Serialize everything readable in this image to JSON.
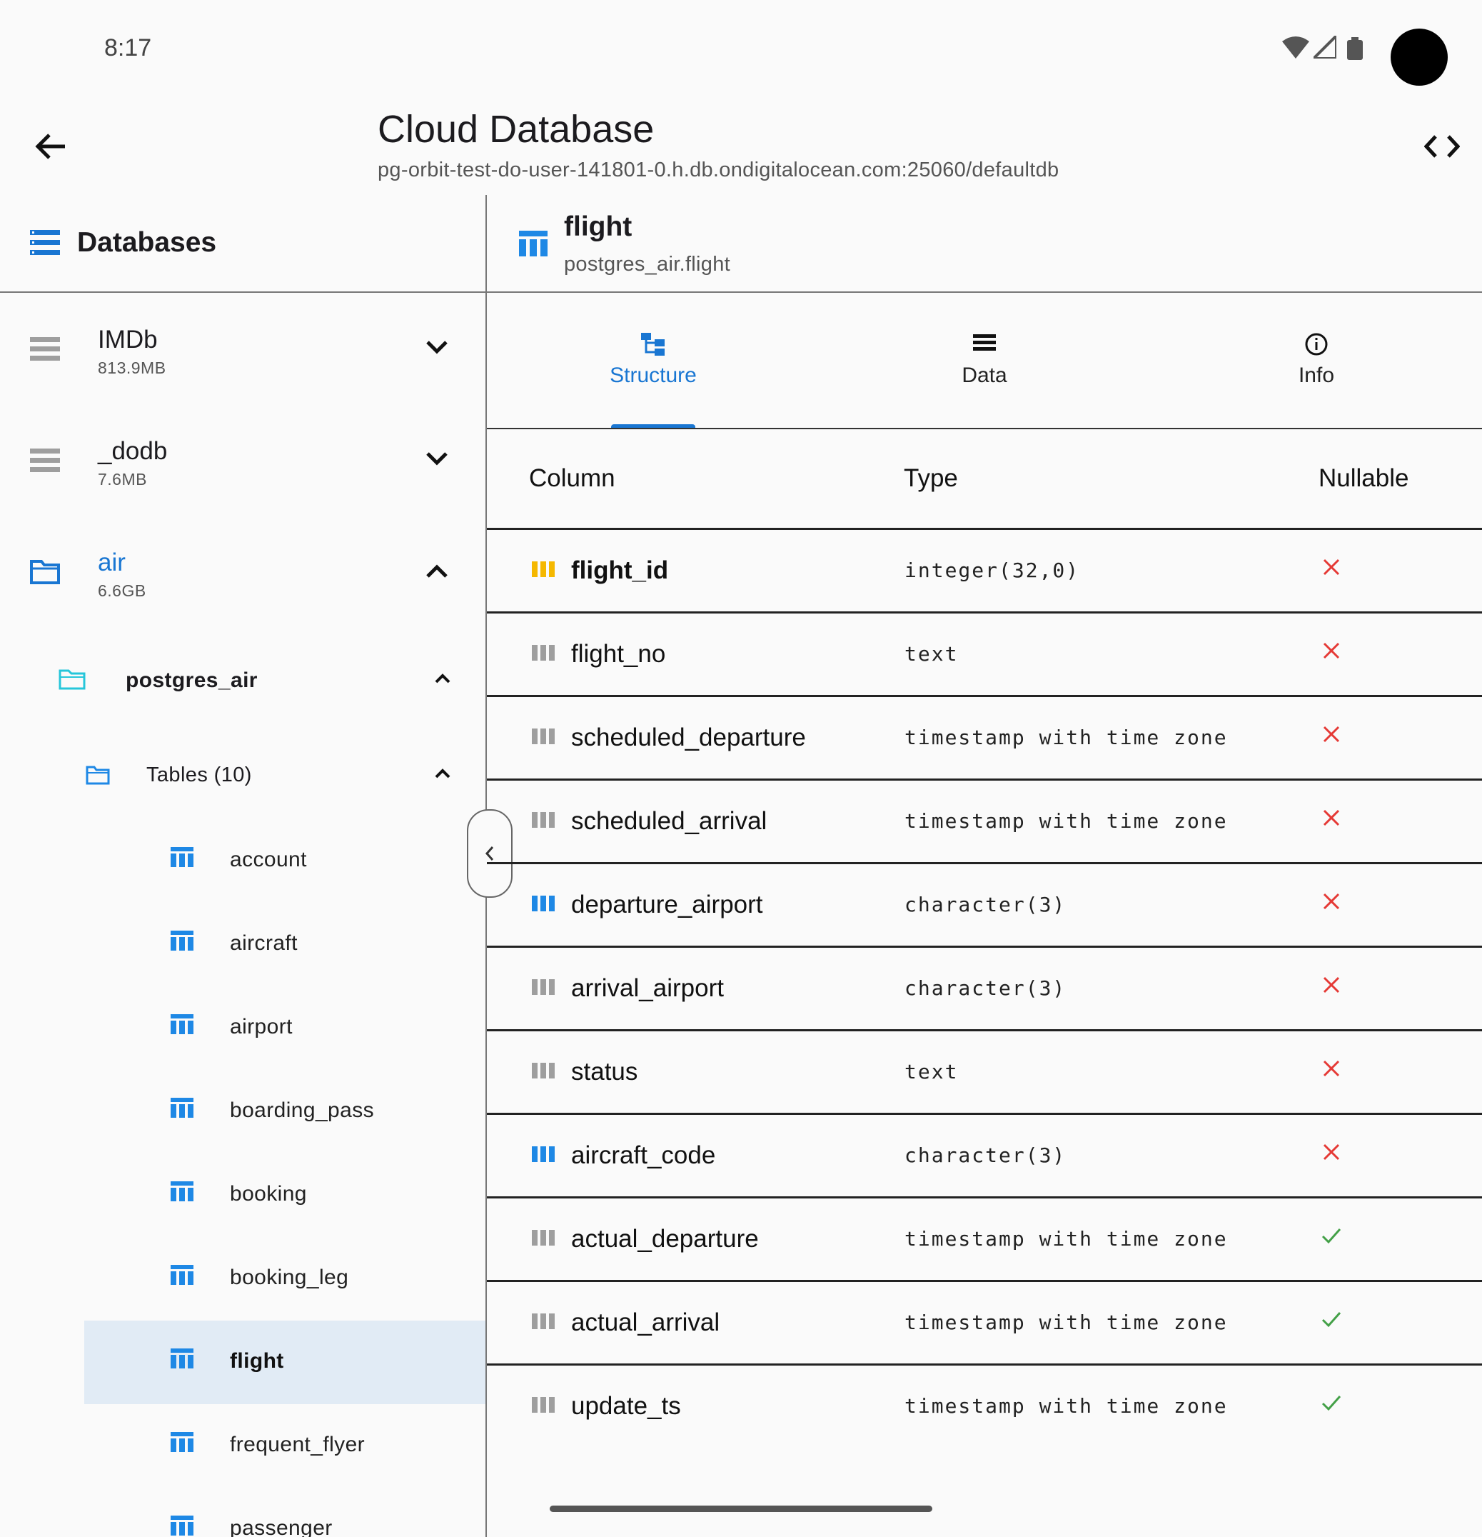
{
  "status_bar": {
    "time": "8:17"
  },
  "app_bar": {
    "title": "Cloud Database",
    "subtitle": "pg-orbit-test-do-user-141801-0.h.db.ondigitalocean.com:25060/defaultdb"
  },
  "sidebar": {
    "header": "Databases",
    "databases": [
      {
        "name": "IMDb",
        "size": "813.9MB",
        "expanded": false
      },
      {
        "name": "_dodb",
        "size": "7.6MB",
        "expanded": false
      },
      {
        "name": "air",
        "size": "6.6GB",
        "expanded": true
      }
    ],
    "schema": "postgres_air",
    "tables_group": "Tables (10)",
    "tables": [
      "account",
      "aircraft",
      "airport",
      "boarding_pass",
      "booking",
      "booking_leg",
      "flight",
      "frequent_flyer",
      "passenger"
    ],
    "selected_table": "flight"
  },
  "main": {
    "table_name": "flight",
    "table_path": "postgres_air.flight",
    "tabs": [
      {
        "label": "Structure",
        "active": true,
        "icon": "structure-icon"
      },
      {
        "label": "Data",
        "active": false,
        "icon": "list-icon"
      },
      {
        "label": "Info",
        "active": false,
        "icon": "info-icon"
      }
    ],
    "headers": {
      "column": "Column",
      "type": "Type",
      "nullable": "Nullable"
    },
    "columns": [
      {
        "name": "flight_id",
        "type": "integer(32,0)",
        "nullable": false,
        "kind": "primary"
      },
      {
        "name": "flight_no",
        "type": "text",
        "nullable": false,
        "kind": "normal"
      },
      {
        "name": "scheduled_departure",
        "type": "timestamp with time zone",
        "nullable": false,
        "kind": "normal"
      },
      {
        "name": "scheduled_arrival",
        "type": "timestamp with time zone",
        "nullable": false,
        "kind": "normal"
      },
      {
        "name": "departure_airport",
        "type": "character(3)",
        "nullable": false,
        "kind": "foreign"
      },
      {
        "name": "arrival_airport",
        "type": "character(3)",
        "nullable": false,
        "kind": "normal"
      },
      {
        "name": "status",
        "type": "text",
        "nullable": false,
        "kind": "normal"
      },
      {
        "name": "aircraft_code",
        "type": "character(3)",
        "nullable": false,
        "kind": "foreign"
      },
      {
        "name": "actual_departure",
        "type": "timestamp with time zone",
        "nullable": true,
        "kind": "normal"
      },
      {
        "name": "actual_arrival",
        "type": "timestamp with time zone",
        "nullable": true,
        "kind": "normal"
      },
      {
        "name": "update_ts",
        "type": "timestamp with time zone",
        "nullable": true,
        "kind": "normal"
      }
    ]
  },
  "colors": {
    "accent": "#1976d2",
    "primary_key": "#f5b800",
    "foreign_key": "#1e88e5",
    "column_icon": "#9e9e9e",
    "not_null": "#e53935",
    "nullable": "#43a047",
    "schema_folder": "#26c6da",
    "selected_bg": "#e1ebf5"
  }
}
